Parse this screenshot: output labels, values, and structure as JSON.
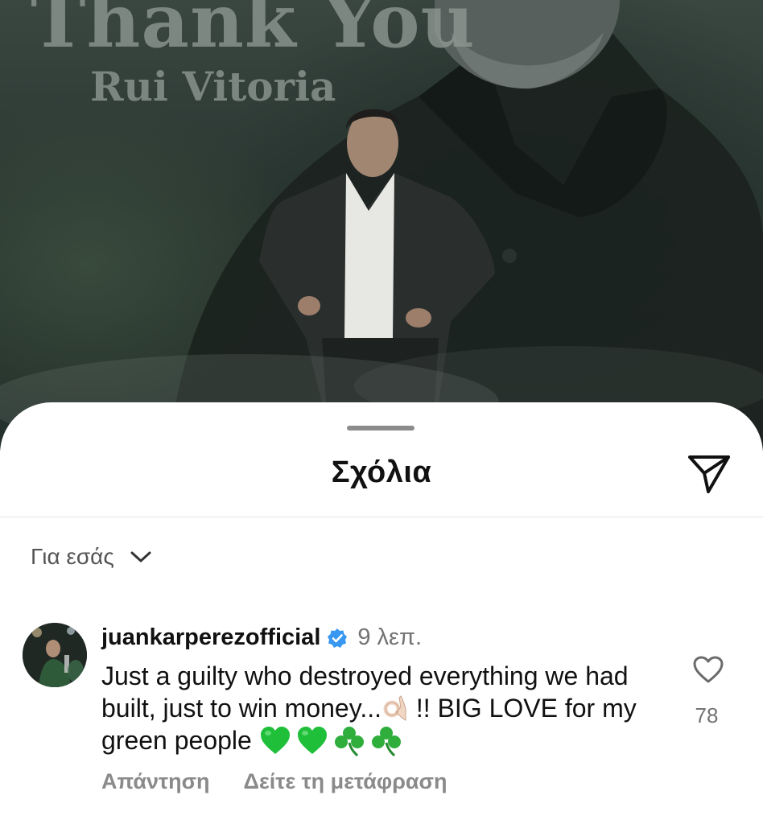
{
  "post": {
    "title": "Thank You",
    "subtitle": "Rui Vitoria"
  },
  "sheet": {
    "title": "Σχόλια",
    "share_icon": "send-icon"
  },
  "filter": {
    "label": "Για εσάς",
    "icon": "chevron-down-icon"
  },
  "comment": {
    "username": "juankarperezofficial",
    "verified": true,
    "timestamp": "9 λεπ.",
    "text": "Just a guilty who destroyed everything we had built, just to win money...",
    "text_after_emoji": "!! BIG LOVE for my green people",
    "emojis": [
      "ok-hand-emoji",
      "green-heart-emoji",
      "green-heart-emoji",
      "shamrock-emoji",
      "shamrock-emoji"
    ],
    "reply_label": "Απάντηση",
    "translate_label": "Δείτε τη μετάφραση",
    "like_count": "78"
  },
  "colors": {
    "accent_verified": "#3897f0",
    "green_heart": "#1fbf3a",
    "shamrock": "#2fae3c",
    "secondary_text": "#737373"
  }
}
